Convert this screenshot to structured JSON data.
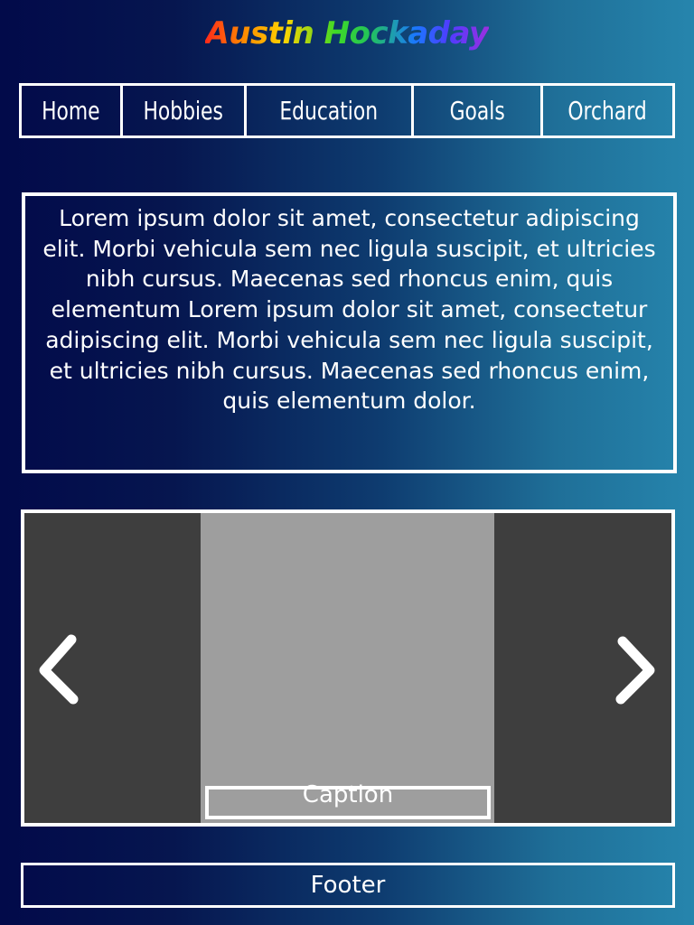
{
  "header": {
    "title": "Austin Hockaday"
  },
  "nav": {
    "items": [
      {
        "label": "Home"
      },
      {
        "label": "Hobbies"
      },
      {
        "label": "Education"
      },
      {
        "label": "Goals"
      },
      {
        "label": "Orchard"
      }
    ]
  },
  "intro": {
    "text": "Lorem ipsum dolor sit amet, consectetur adipiscing elit. Morbi vehicula sem nec ligula suscipit, et ultricies nibh cursus. Maecenas sed rhoncus enim, quis elementum Lorem ipsum dolor sit amet, consectetur adipiscing elit. Morbi vehicula sem nec ligula suscipit, et ultricies nibh cursus. Maecenas sed rhoncus enim, quis elementum dolor."
  },
  "carousel": {
    "caption": "Caption",
    "prev_icon": "chevron-left-icon",
    "next_icon": "chevron-right-icon",
    "background_color": "#3e3e3e"
  },
  "footer": {
    "text": "Footer"
  },
  "colors": {
    "gradient_start": "#020a4a",
    "gradient_end": "#2685ad",
    "border": "#ffffff",
    "text": "#ffffff"
  }
}
